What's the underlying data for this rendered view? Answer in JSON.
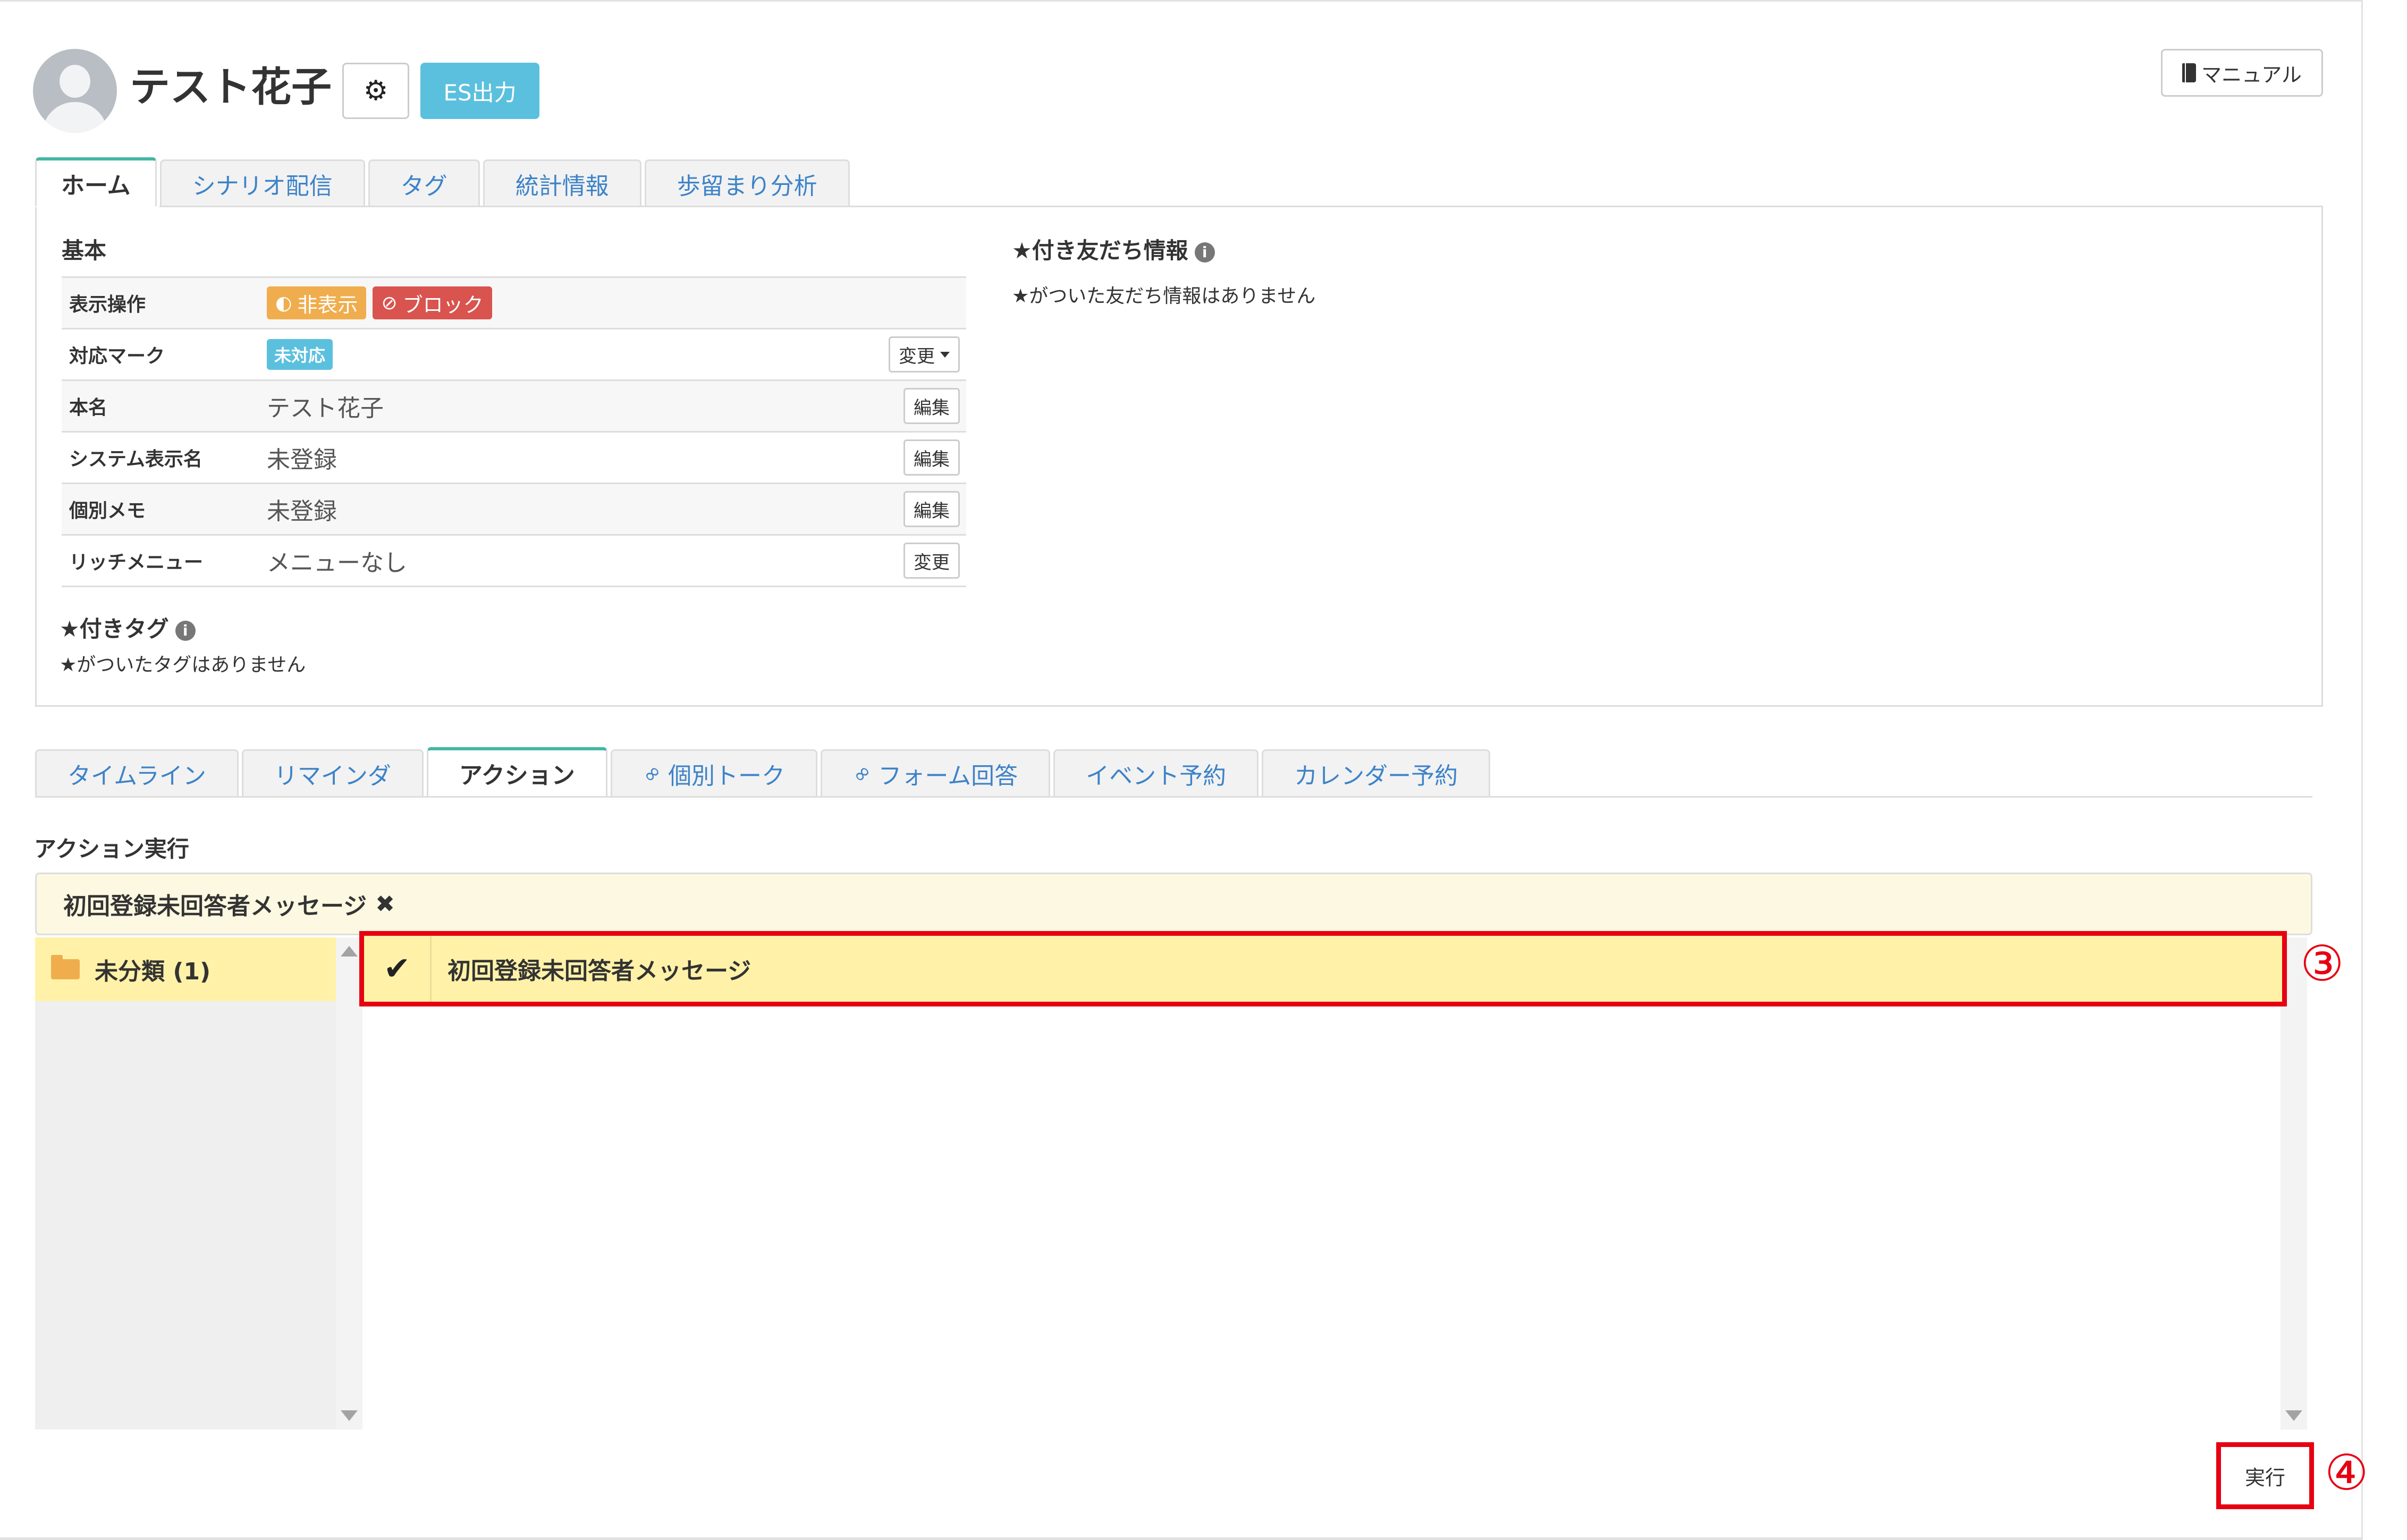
{
  "header": {
    "username": "テスト花子",
    "settings_icon": "⚙",
    "es_button": "ES出力",
    "manual_button": "マニュアル"
  },
  "main_tabs": [
    "ホーム",
    "シナリオ配信",
    "タグ",
    "統計情報",
    "歩留まり分析"
  ],
  "basic": {
    "title": "基本",
    "rows": [
      {
        "label": "表示操作",
        "hide_badge": "非表示",
        "block_badge": "ブロック"
      },
      {
        "label": "対応マーク",
        "mark_badge": "未対応",
        "button": "変更"
      },
      {
        "label": "本名",
        "value": "テスト花子",
        "button": "編集"
      },
      {
        "label": "システム表示名",
        "value": "未登録",
        "button": "編集"
      },
      {
        "label": "個別メモ",
        "value": "未登録",
        "button": "編集"
      },
      {
        "label": "リッチメニュー",
        "value": "メニューなし",
        "button": "変更"
      }
    ]
  },
  "star_tags": {
    "title": "★付きタグ",
    "empty": "★がついたタグはありません"
  },
  "star_friends": {
    "title": "★付き友だち情報",
    "empty": "★がついた友だち情報はありません"
  },
  "sub_tabs": [
    "タイムライン",
    "リマインダ",
    "アクション",
    "個別トーク",
    "フォーム回答",
    "イベント予約",
    "カレンダー予約"
  ],
  "action": {
    "title": "アクション実行",
    "selected": "初回登録未回答者メッセージ",
    "remove_icon": "✖",
    "folder": "未分類 (1)",
    "item": "初回登録未回答者メッセージ",
    "check_icon": "✔",
    "execute_button": "実行",
    "callout_3": "③",
    "callout_4": "④"
  },
  "colors": {
    "accent_tab": "#44b7a3",
    "info_button": "#5bc0de",
    "highlight": "#fff2a8",
    "annotation_red": "#e60012"
  }
}
